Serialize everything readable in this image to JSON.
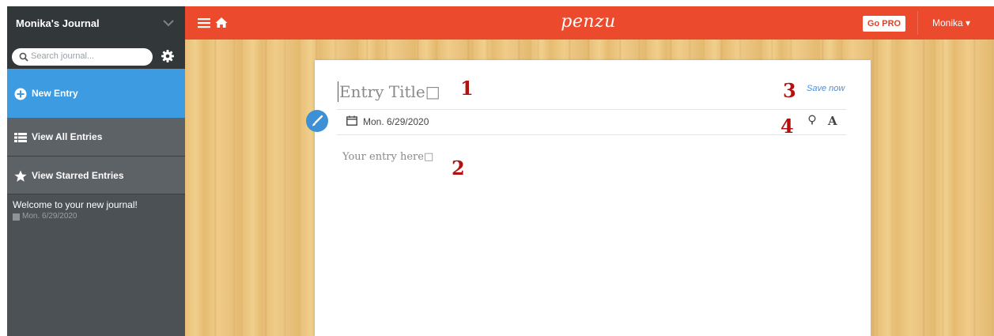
{
  "sidebar": {
    "journal_name": "Monika's Journal",
    "search_placeholder": "Search journal...",
    "nav": [
      {
        "label": "New Entry",
        "icon": "plus-circle-icon"
      },
      {
        "label": "View All Entries",
        "icon": "list-icon"
      },
      {
        "label": "View Starred Entries",
        "icon": "star-icon"
      }
    ],
    "entries": [
      {
        "title": "Welcome to your new journal!",
        "date": "Mon. 6/29/2020"
      }
    ]
  },
  "topbar": {
    "brand": "penzu",
    "go_pro": "Go PRO",
    "user": "Monika ▾"
  },
  "editor": {
    "title_placeholder": "Entry Title□",
    "save_label": "Save now",
    "date": "Mon. 6/29/2020",
    "font_glyph": "A",
    "body_placeholder": "Your entry here□"
  },
  "annotations": [
    "1",
    "2",
    "3",
    "4"
  ],
  "colors": {
    "topbar": "#ec4a2d",
    "sidebar": "#4b5155",
    "sidebar_header": "#32373a",
    "accent": "#3d9be2",
    "annotation": "#b3110f"
  }
}
